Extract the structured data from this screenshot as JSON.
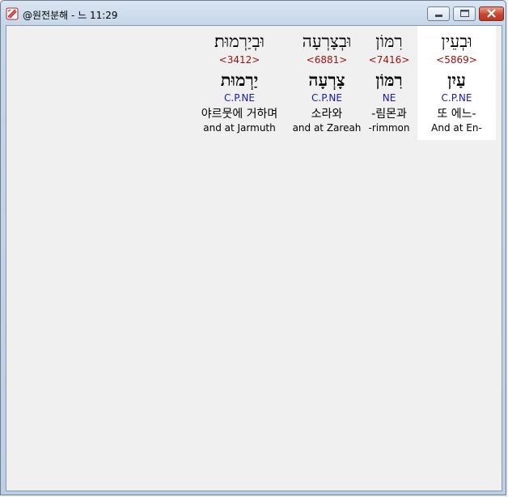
{
  "window": {
    "title": "@원전분해 - 느 11:29"
  },
  "words": [
    {
      "hebrew": "וּבְעֵין",
      "strong": "<5869>",
      "root": "עַיִן",
      "grammar": "C.P.NE",
      "korean": "또 에느-",
      "english": "And at En-",
      "selected": true
    },
    {
      "hebrew": "רִמּוֹן",
      "strong": "<7416>",
      "root": "רִמּוֹן",
      "grammar": "NE",
      "korean": "-림몬과",
      "english": "-rimmon",
      "selected": false
    },
    {
      "hebrew": "וּבְצָרְעָה",
      "strong": "<6881>",
      "root": "צָרְעָה",
      "grammar": "C.P.NE",
      "korean": "소라와",
      "english": "and at Zareah",
      "selected": false
    },
    {
      "hebrew": "וּבְיַרְמוּת׃",
      "strong": "<3412>",
      "root": "יַרְמוּת",
      "grammar": "C.P.NE",
      "korean": "야르뭇에 거하며",
      "english": "and at Jarmuth",
      "selected": false
    }
  ]
}
